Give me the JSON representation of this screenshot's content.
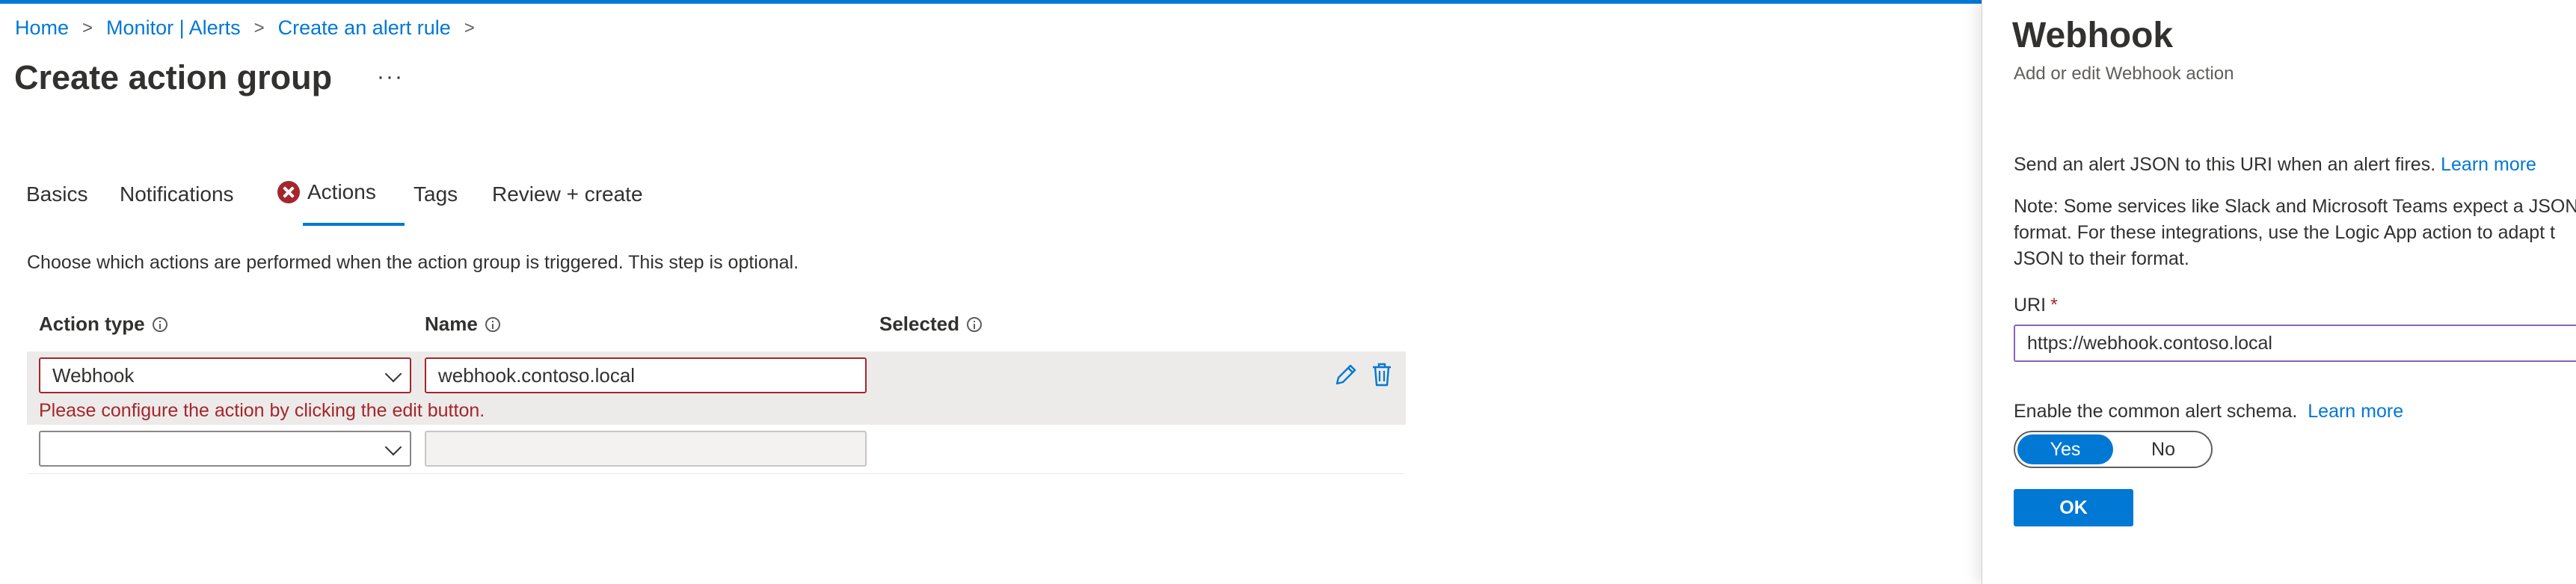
{
  "breadcrumb": {
    "items": [
      "Home",
      "Monitor | Alerts",
      "Create an alert rule"
    ]
  },
  "page": {
    "title": "Create action group",
    "more_label": "···"
  },
  "tabs": [
    {
      "label": "Basics"
    },
    {
      "label": "Notifications"
    },
    {
      "label": "Actions",
      "active": true,
      "status": "error"
    },
    {
      "label": "Tags"
    },
    {
      "label": "Review + create"
    }
  ],
  "actions": {
    "description": "Choose which actions are performed when the action group is triggered. This step is optional.",
    "columns": [
      "Action type",
      "Name",
      "Selected"
    ],
    "rows": [
      {
        "action_type": "Webhook",
        "name": "webhook.contoso.local",
        "error": "Please configure the action by clicking the edit button."
      },
      {
        "action_type": "",
        "name": ""
      }
    ]
  },
  "icons": {
    "tab_error": "error-circle-icon",
    "info": "info-icon",
    "edit": "pencil-icon",
    "delete": "trash-icon",
    "dropdown": "chevron-down-icon"
  },
  "panel": {
    "title": "Webhook",
    "subtitle": "Add or edit Webhook action",
    "intro": "Send an alert JSON to this URI when an alert fires.",
    "intro_link": "Learn more",
    "note_lines": [
      "Note: Some services like Slack and Microsoft Teams expect a JSON",
      "format. For these integrations, use the Logic App action to adapt t",
      "JSON to their format."
    ],
    "uri_label": "URI",
    "uri_required": "*",
    "uri_value": "https://webhook.contoso.local",
    "schema_label": "Enable the common alert schema.",
    "schema_link": "Learn more",
    "toggle": {
      "yes": "Yes",
      "no": "No",
      "selected": "Yes"
    },
    "ok_label": "OK"
  },
  "colors": {
    "accent": "#0078d4",
    "error": "#a4262c",
    "focus_border": "#8764b8",
    "row_highlight": "#edebe9"
  }
}
